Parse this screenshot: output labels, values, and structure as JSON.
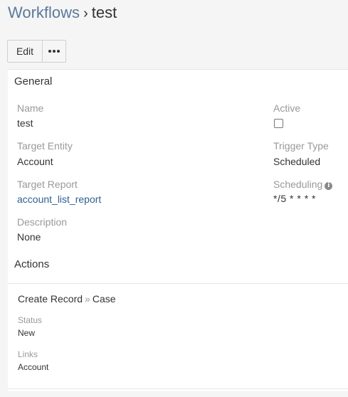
{
  "breadcrumb": {
    "parent": "Workflows",
    "separator": "›",
    "current": "test"
  },
  "toolbar": {
    "edit_label": "Edit",
    "more_label": "•••"
  },
  "general": {
    "heading": "General",
    "name_label": "Name",
    "name_value": "test",
    "active_label": "Active",
    "active_checked": false,
    "target_entity_label": "Target Entity",
    "target_entity_value": "Account",
    "trigger_type_label": "Trigger Type",
    "trigger_type_value": "Scheduled",
    "target_report_label": "Target Report",
    "target_report_value": "account_list_report",
    "scheduling_label": "Scheduling",
    "scheduling_value": "*/5 * * * *",
    "description_label": "Description",
    "description_value": "None"
  },
  "actions": {
    "heading": "Actions",
    "items": [
      {
        "type": "Create Record",
        "separator": "»",
        "target": "Case",
        "status_label": "Status",
        "status_value": "New",
        "links_label": "Links",
        "links_value": "Account"
      }
    ]
  },
  "icons": {
    "more": "ellipsis-icon",
    "scheduling_info": "info-icon",
    "active": "checkbox"
  }
}
